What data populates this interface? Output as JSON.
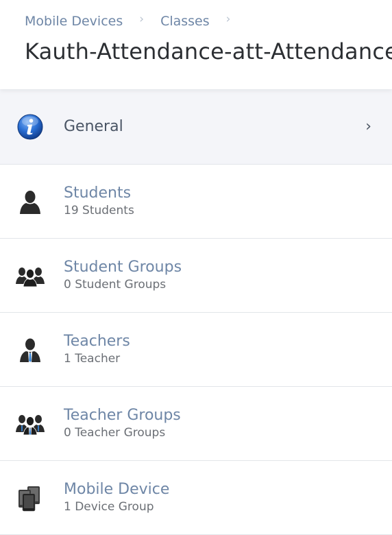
{
  "breadcrumb": {
    "items": [
      "Mobile Devices",
      "Classes"
    ],
    "separator": "›"
  },
  "title": "Kauth-Attendance-att-Attendance",
  "rows": [
    {
      "title": "General",
      "subtitle": "",
      "icon": "info-icon",
      "chevron": "›"
    },
    {
      "title": "Students",
      "subtitle": "19 Students",
      "icon": "student-icon"
    },
    {
      "title": "Student Groups",
      "subtitle": "0 Student Groups",
      "icon": "student-groups-icon"
    },
    {
      "title": "Teachers",
      "subtitle": "1 Teacher",
      "icon": "teacher-icon"
    },
    {
      "title": "Teacher Groups",
      "subtitle": "0 Teacher Groups",
      "icon": "teacher-groups-icon"
    },
    {
      "title": "Mobile Device",
      "subtitle": "1 Device Group",
      "icon": "mobile-devices-icon"
    }
  ],
  "colors": {
    "link": "#6e86a6",
    "selected_row_bg": "#f4f5f9",
    "info_icon_blue": "#2a6fd4"
  }
}
